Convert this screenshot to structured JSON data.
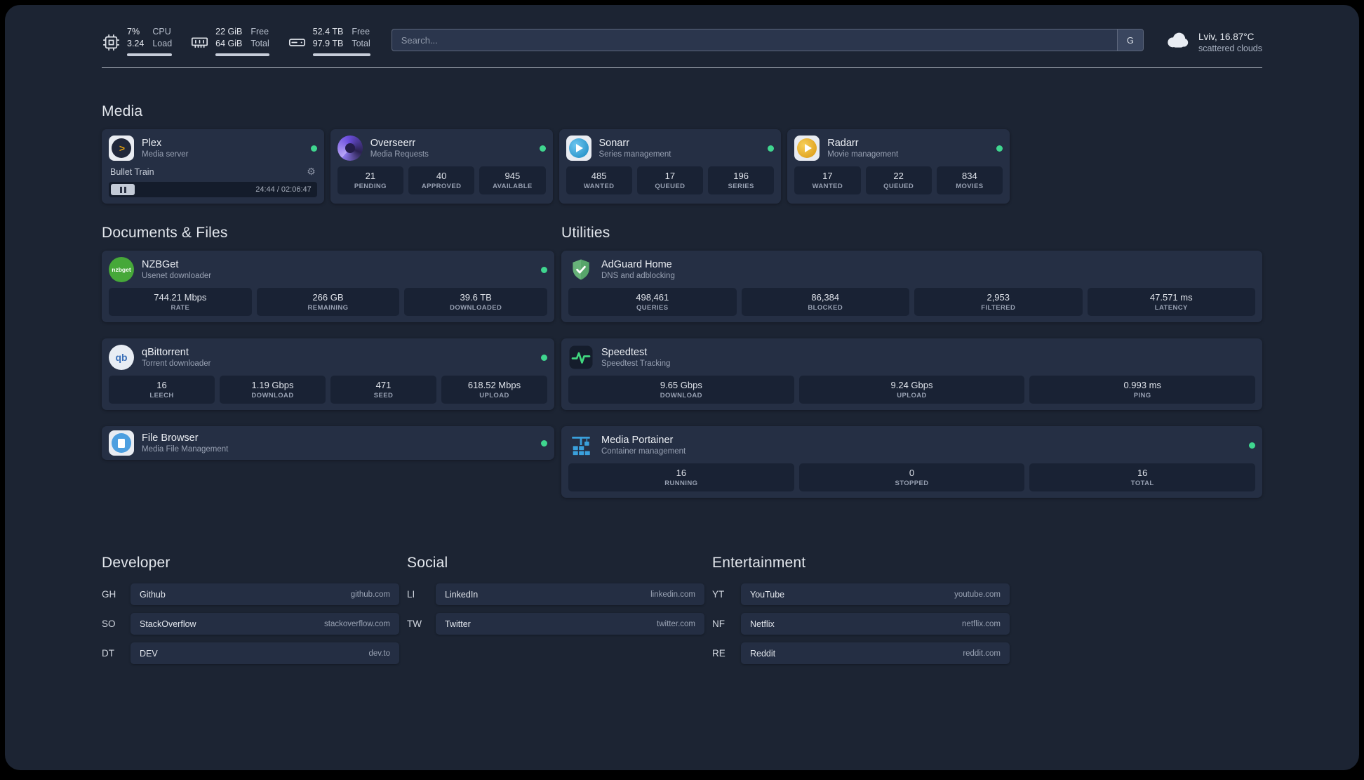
{
  "topbar": {
    "cpu": {
      "percent": "7%",
      "load": "3.24",
      "label_top": "CPU",
      "label_bottom": "Load"
    },
    "memory": {
      "free": "22 GiB",
      "total": "64 GiB",
      "label_top": "Free",
      "label_bottom": "Total"
    },
    "disk": {
      "free": "52.4 TB",
      "total": "97.9 TB",
      "label_top": "Free",
      "label_bottom": "Total"
    },
    "search": {
      "placeholder": "Search...",
      "provider": "G"
    },
    "weather": {
      "location": "Lviv, 16.87°C",
      "condition": "scattered clouds"
    }
  },
  "colors": {
    "status_online": "#3fd68f"
  },
  "media": {
    "title": "Media",
    "plex": {
      "name": "Plex",
      "desc": "Media server",
      "now_playing": "Bullet Train",
      "time": "24:44 / 02:06:47"
    },
    "overseerr": {
      "name": "Overseerr",
      "desc": "Media Requests",
      "stats": [
        {
          "value": "21",
          "label": "PENDING"
        },
        {
          "value": "40",
          "label": "APPROVED"
        },
        {
          "value": "945",
          "label": "AVAILABLE"
        }
      ]
    },
    "sonarr": {
      "name": "Sonarr",
      "desc": "Series management",
      "stats": [
        {
          "value": "485",
          "label": "WANTED"
        },
        {
          "value": "17",
          "label": "QUEUED"
        },
        {
          "value": "196",
          "label": "SERIES"
        }
      ]
    },
    "radarr": {
      "name": "Radarr",
      "desc": "Movie management",
      "stats": [
        {
          "value": "17",
          "label": "WANTED"
        },
        {
          "value": "22",
          "label": "QUEUED"
        },
        {
          "value": "834",
          "label": "MOVIES"
        }
      ]
    }
  },
  "documents": {
    "title": "Documents & Files",
    "nzbget": {
      "name": "NZBGet",
      "desc": "Usenet downloader",
      "icon_text": "nzbget",
      "stats": [
        {
          "value": "744.21 Mbps",
          "label": "RATE"
        },
        {
          "value": "266 GB",
          "label": "REMAINING"
        },
        {
          "value": "39.6 TB",
          "label": "DOWNLOADED"
        }
      ]
    },
    "qbittorrent": {
      "name": "qBittorrent",
      "desc": "Torrent downloader",
      "icon_text": "qb",
      "stats": [
        {
          "value": "16",
          "label": "LEECH"
        },
        {
          "value": "1.19 Gbps",
          "label": "DOWNLOAD"
        },
        {
          "value": "471",
          "label": "SEED"
        },
        {
          "value": "618.52 Mbps",
          "label": "UPLOAD"
        }
      ]
    },
    "filebrowser": {
      "name": "File Browser",
      "desc": "Media File Management"
    }
  },
  "utilities": {
    "title": "Utilities",
    "adguard": {
      "name": "AdGuard Home",
      "desc": "DNS and adblocking",
      "stats": [
        {
          "value": "498,461",
          "label": "QUERIES"
        },
        {
          "value": "86,384",
          "label": "BLOCKED"
        },
        {
          "value": "2,953",
          "label": "FILTERED"
        },
        {
          "value": "47.571 ms",
          "label": "LATENCY"
        }
      ]
    },
    "speedtest": {
      "name": "Speedtest",
      "desc": "Speedtest Tracking",
      "stats": [
        {
          "value": "9.65 Gbps",
          "label": "DOWNLOAD"
        },
        {
          "value": "9.24 Gbps",
          "label": "UPLOAD"
        },
        {
          "value": "0.993 ms",
          "label": "PING"
        }
      ]
    },
    "portainer": {
      "name": "Media Portainer",
      "desc": "Container management",
      "stats": [
        {
          "value": "16",
          "label": "RUNNING"
        },
        {
          "value": "0",
          "label": "STOPPED"
        },
        {
          "value": "16",
          "label": "TOTAL"
        }
      ]
    }
  },
  "bookmarks": {
    "developer": {
      "title": "Developer",
      "items": [
        {
          "abbr": "GH",
          "name": "Github",
          "url": "github.com"
        },
        {
          "abbr": "SO",
          "name": "StackOverflow",
          "url": "stackoverflow.com"
        },
        {
          "abbr": "DT",
          "name": "DEV",
          "url": "dev.to"
        }
      ]
    },
    "social": {
      "title": "Social",
      "items": [
        {
          "abbr": "LI",
          "name": "LinkedIn",
          "url": "linkedin.com"
        },
        {
          "abbr": "TW",
          "name": "Twitter",
          "url": "twitter.com"
        }
      ]
    },
    "entertainment": {
      "title": "Entertainment",
      "items": [
        {
          "abbr": "YT",
          "name": "YouTube",
          "url": "youtube.com"
        },
        {
          "abbr": "NF",
          "name": "Netflix",
          "url": "netflix.com"
        },
        {
          "abbr": "RE",
          "name": "Reddit",
          "url": "reddit.com"
        }
      ]
    }
  }
}
